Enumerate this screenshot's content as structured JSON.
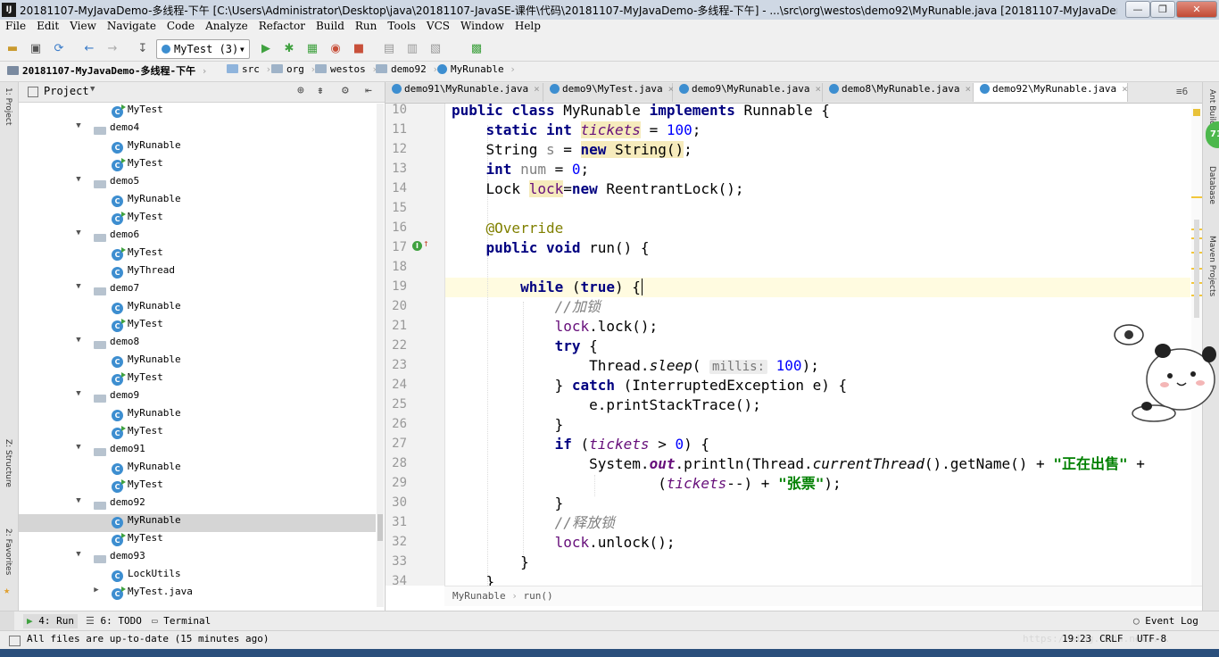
{
  "window": {
    "app_icon": "IJ",
    "title": "20181107-MyJavaDemo-多线程-下午 [C:\\Users\\Administrator\\Desktop\\java\\20181107-JavaSE-课件\\代码\\20181107-MyJavaDemo-多线程-下午] - ...\\src\\org\\westos\\demo92\\MyRunable.java [20181107-MyJavaDemo...",
    "min": "—",
    "max": "❐",
    "close": "✕"
  },
  "menu": [
    "File",
    "Edit",
    "View",
    "Navigate",
    "Code",
    "Analyze",
    "Refactor",
    "Build",
    "Run",
    "Tools",
    "VCS",
    "Window",
    "Help"
  ],
  "toolbar": {
    "run_config": "MyTest (3)",
    "chevron": "▾"
  },
  "breadcrumb": [
    "20181107-MyJavaDemo-多线程-下午",
    "src",
    "org",
    "westos",
    "demo92",
    "MyRunable"
  ],
  "left_strip": {
    "top": "1: Project",
    "mid": "Z: Structure",
    "bottom": "2: Favorites"
  },
  "right_strip": {
    "top": "Ant Build",
    "mid": "Database",
    "bottom": "Maven Projects",
    "badge": "71"
  },
  "project": {
    "header": "Project",
    "rows": [
      {
        "type": "class",
        "label": "MyTest",
        "run": true,
        "indent": 2
      },
      {
        "type": "pkg",
        "label": "demo4",
        "indent": 1
      },
      {
        "type": "class",
        "label": "MyRunable",
        "run": false,
        "indent": 2
      },
      {
        "type": "class",
        "label": "MyTest",
        "run": true,
        "indent": 2
      },
      {
        "type": "pkg",
        "label": "demo5",
        "indent": 1
      },
      {
        "type": "class",
        "label": "MyRunable",
        "run": false,
        "indent": 2
      },
      {
        "type": "class",
        "label": "MyTest",
        "run": true,
        "indent": 2
      },
      {
        "type": "pkg",
        "label": "demo6",
        "indent": 1
      },
      {
        "type": "class",
        "label": "MyTest",
        "run": true,
        "indent": 2
      },
      {
        "type": "class",
        "label": "MyThread",
        "run": false,
        "indent": 2
      },
      {
        "type": "pkg",
        "label": "demo7",
        "indent": 1
      },
      {
        "type": "class",
        "label": "MyRunable",
        "run": false,
        "indent": 2
      },
      {
        "type": "class",
        "label": "MyTest",
        "run": true,
        "indent": 2
      },
      {
        "type": "pkg",
        "label": "demo8",
        "indent": 1
      },
      {
        "type": "class",
        "label": "MyRunable",
        "run": false,
        "indent": 2
      },
      {
        "type": "class",
        "label": "MyTest",
        "run": true,
        "indent": 2
      },
      {
        "type": "pkg",
        "label": "demo9",
        "indent": 1
      },
      {
        "type": "class",
        "label": "MyRunable",
        "run": false,
        "indent": 2
      },
      {
        "type": "class",
        "label": "MyTest",
        "run": true,
        "indent": 2
      },
      {
        "type": "pkg",
        "label": "demo91",
        "indent": 1
      },
      {
        "type": "class",
        "label": "MyRunable",
        "run": false,
        "indent": 2
      },
      {
        "type": "class",
        "label": "MyTest",
        "run": true,
        "indent": 2
      },
      {
        "type": "pkg",
        "label": "demo92",
        "indent": 1
      },
      {
        "type": "class",
        "label": "MyRunable",
        "run": false,
        "indent": 2,
        "selected": true
      },
      {
        "type": "class",
        "label": "MyTest",
        "run": true,
        "indent": 2
      },
      {
        "type": "pkg",
        "label": "demo93",
        "indent": 1
      },
      {
        "type": "class",
        "label": "LockUtils",
        "run": false,
        "indent": 2
      },
      {
        "type": "file",
        "label": "MyTest.java",
        "run": true,
        "indent": 1
      }
    ]
  },
  "tabs": [
    {
      "label": "demo91\\MyRunable.java",
      "active": false
    },
    {
      "label": "demo9\\MyTest.java",
      "active": false
    },
    {
      "label": "demo9\\MyRunable.java",
      "active": false
    },
    {
      "label": "demo8\\MyRunable.java",
      "active": false
    },
    {
      "label": "demo92\\MyRunable.java",
      "active": true
    }
  ],
  "tabs_more": "≡6",
  "editor": {
    "first_line": 10,
    "current_line": 19,
    "breadcrumb": [
      "MyRunable",
      "run()"
    ]
  },
  "bottom_tools": [
    "4: Run",
    "6: TODO",
    "Terminal"
  ],
  "event_log": "Event Log",
  "status": {
    "message": "All files are up-to-date (15 minutes ago)",
    "position": "19:23",
    "line_sep": "CRLF",
    "encoding": "UTF-8",
    "watermark": "https://blog.csdn.net/..."
  }
}
